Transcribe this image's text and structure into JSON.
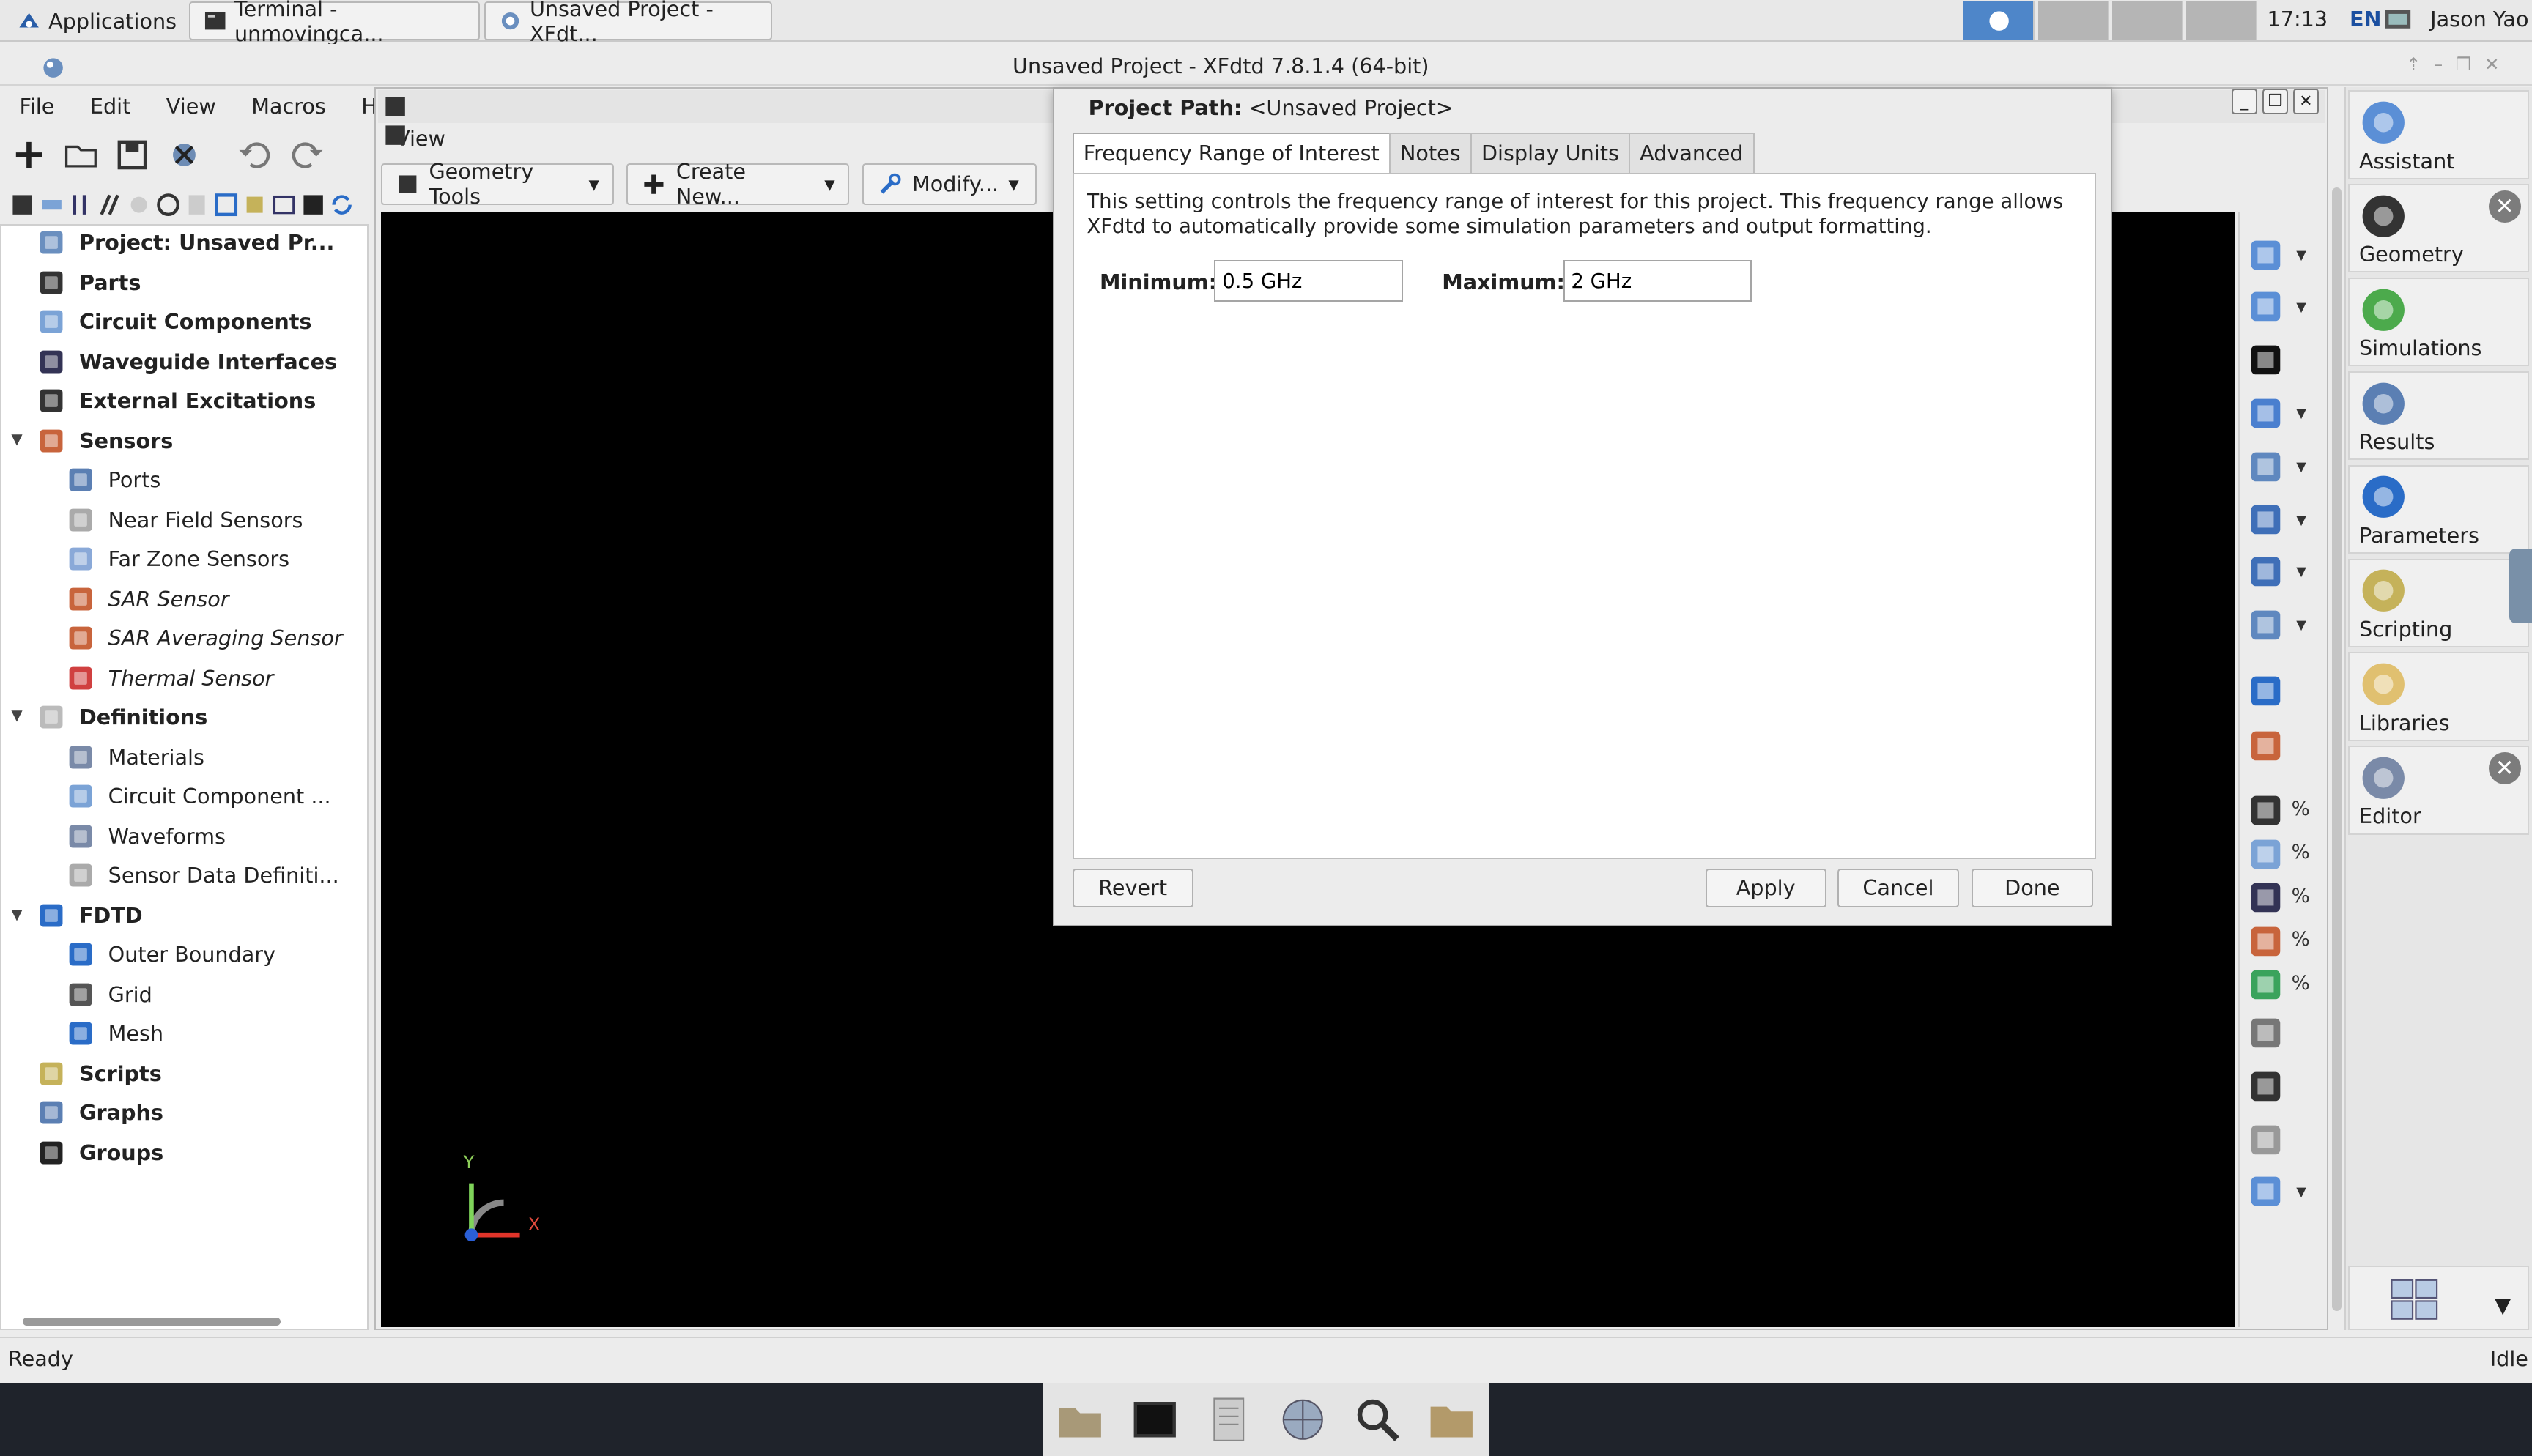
{
  "top_panel": {
    "applications": "Applications",
    "tasks": [
      "Terminal - unmovingca...",
      "Unsaved Project - XFdt..."
    ],
    "clock": "17:13",
    "lang": "EN",
    "user": "Jason Yao"
  },
  "window": {
    "title": "Unsaved Project - XFdtd 7.8.1.4 (64-bit)"
  },
  "menu": [
    "File",
    "Edit",
    "View",
    "Macros",
    "Help"
  ],
  "tree": {
    "project": "Project: Unsaved Pr...",
    "parts": "Parts",
    "circuit": "Circuit Components",
    "waveguide": "Waveguide Interfaces",
    "excitations": "External Excitations",
    "sensors": "Sensors",
    "sensor_items": [
      "Ports",
      "Near Field Sensors",
      "Far Zone Sensors",
      "SAR Sensor",
      "SAR Averaging Sensor",
      "Thermal Sensor"
    ],
    "definitions": "Definitions",
    "def_items": [
      "Materials",
      "Circuit Component ...",
      "Waveforms",
      "Sensor Data Definiti..."
    ],
    "fdtd": "FDTD",
    "fdtd_items": [
      "Outer Boundary",
      "Grid",
      "Mesh"
    ],
    "scripts": "Scripts",
    "graphs": "Graphs",
    "groups": "Groups"
  },
  "viewport": {
    "view_menu": "View",
    "geometry_tools": "Geometry Tools",
    "create_new": "Create New...",
    "modify": "Modify...",
    "axis_y": "Y",
    "axis_x": "X"
  },
  "dialog": {
    "project_path_label": "Project Path:",
    "project_path_value": "<Unsaved Project>",
    "tabs": [
      "Frequency Range of Interest",
      "Notes",
      "Display Units",
      "Advanced"
    ],
    "description": "This setting controls the frequency range of interest for this project. This frequency range allows XFdtd to automatically provide some simulation parameters and output formatting.",
    "min_label": "Minimum:",
    "min_value": "0.5 GHz",
    "max_label": "Maximum:",
    "max_value": "2 GHz",
    "revert": "Revert",
    "apply": "Apply",
    "cancel": "Cancel",
    "done": "Done"
  },
  "dock": [
    "Assistant",
    "Geometry",
    "Simulations",
    "Results",
    "Parameters",
    "Scripting",
    "Libraries",
    "Editor"
  ],
  "percent": "%",
  "status": {
    "left": "Ready",
    "right": "Idle"
  },
  "colors": {
    "accent_blue": "#2a6cc7",
    "canvas": "#000000",
    "taskbar": "#1f232b"
  }
}
